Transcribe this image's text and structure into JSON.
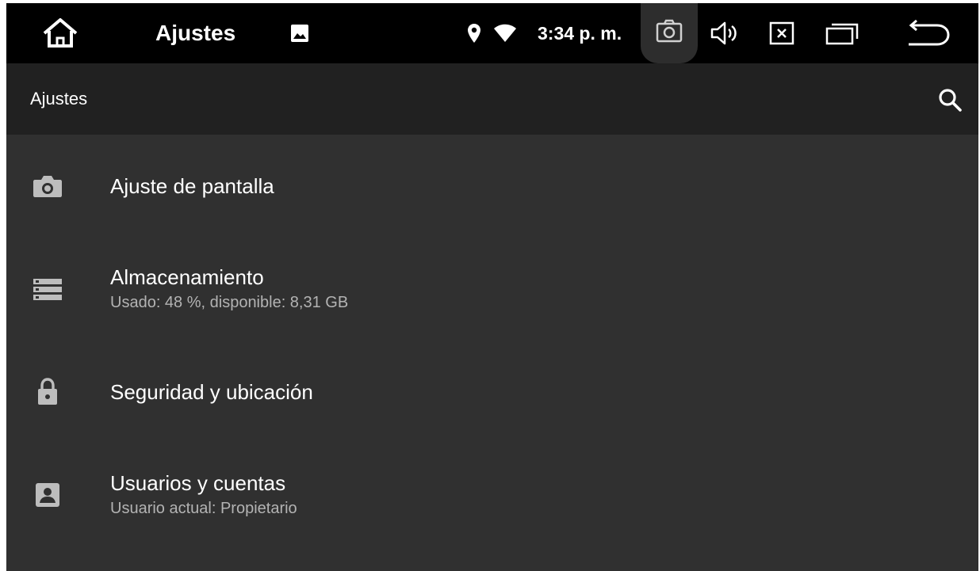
{
  "status_bar": {
    "title": "Ajustes",
    "clock": "3:34 p. m.",
    "icons": [
      "home-icon",
      "image-icon",
      "location-icon",
      "wifi-icon",
      "screenshot-camera-icon",
      "volume-icon",
      "close-box-icon",
      "recents-icon",
      "back-icon"
    ]
  },
  "app_bar": {
    "title": "Ajustes",
    "search_icon": "search-icon"
  },
  "settings": {
    "items": [
      {
        "title": "Ajuste de pantalla",
        "subtitle": "",
        "icon": "camera-icon"
      },
      {
        "title": "Almacenamiento",
        "subtitle": "Usado: 48 %, disponible: 8,31 GB",
        "icon": "storage-icon"
      },
      {
        "title": "Seguridad y ubicación",
        "subtitle": "",
        "icon": "lock-icon"
      },
      {
        "title": "Usuarios y cuentas",
        "subtitle": "Usuario actual: Propietario",
        "icon": "account-box-icon"
      }
    ]
  },
  "colors": {
    "status_bar_bg": "#000000",
    "app_bar_bg": "#212121",
    "list_bg": "#303030",
    "text_primary": "#ffffff",
    "text_secondary": "#b3b3b3",
    "icon": "#bdbdbd"
  }
}
